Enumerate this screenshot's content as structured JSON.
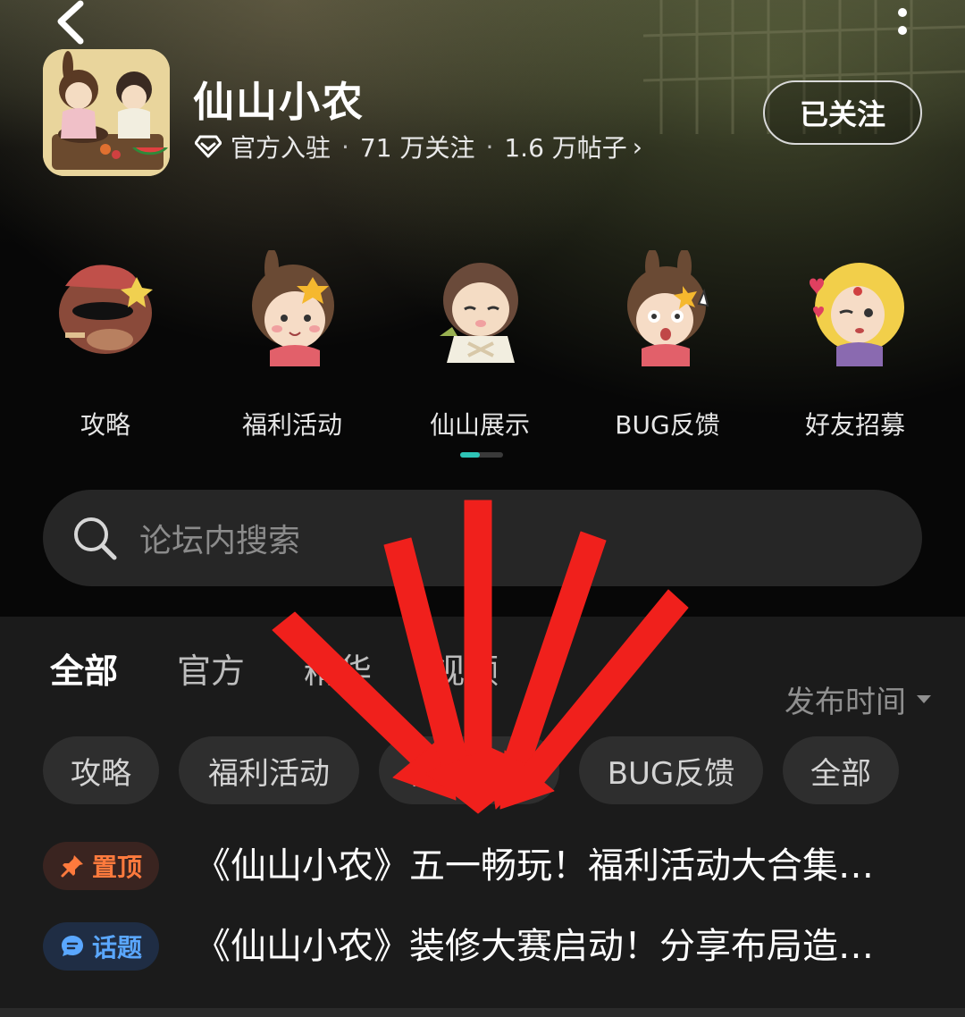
{
  "header": {
    "title": "仙山小农",
    "verified_label": "官方入驻",
    "separator": "·",
    "followers": "71 万关注",
    "posts": "1.6 万帖子",
    "chevron": "›",
    "follow_button": "已关注"
  },
  "categories": [
    {
      "label": "攻略",
      "icon": "character-boar-avatar-icon"
    },
    {
      "label": "福利活动",
      "icon": "character-girl-flower-avatar-icon"
    },
    {
      "label": "仙山展示",
      "icon": "character-boy-avatar-icon"
    },
    {
      "label": "BUG反馈",
      "icon": "character-girl-surprised-avatar-icon"
    },
    {
      "label": "好友招募",
      "icon": "character-blonde-avatar-icon"
    }
  ],
  "search": {
    "placeholder": "论坛内搜索"
  },
  "tabs": [
    {
      "label": "全部",
      "active": true
    },
    {
      "label": "官方",
      "active": false
    },
    {
      "label": "精华",
      "active": false
    },
    {
      "label": "视频",
      "active": false
    }
  ],
  "sort": {
    "label": "发布时间"
  },
  "chips": [
    "攻略",
    "福利活动",
    "仙山展示",
    "BUG反馈",
    "全部"
  ],
  "posts": [
    {
      "badge": "置顶",
      "badge_icon": "pin-icon",
      "title": "《仙山小农》五一畅玩！福利活动大合集…"
    },
    {
      "badge": "话题",
      "badge_icon": "chat-bubble-icon",
      "title": "《仙山小农》装修大赛启动！分享布局造…"
    }
  ],
  "colors": {
    "accent": "#18b3a4",
    "pin": "#ff7a3d",
    "topic": "#5aa7ff",
    "annotation_arrows": "#f0201c"
  }
}
